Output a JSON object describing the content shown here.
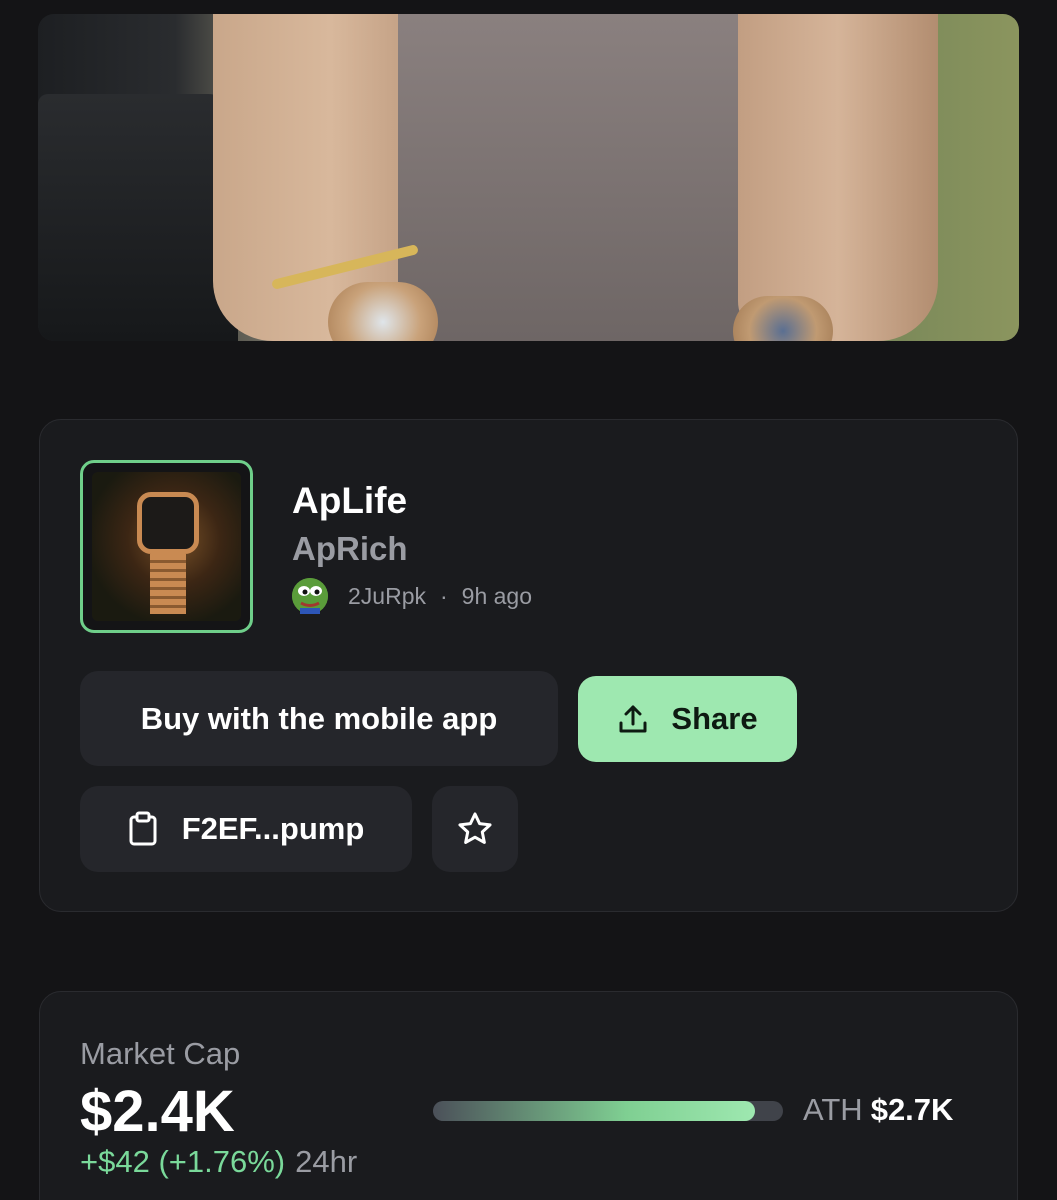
{
  "token": {
    "name": "ApLife",
    "ticker": "ApRich",
    "creator": "2JuRpk",
    "separator": "·",
    "age": "9h ago"
  },
  "actions": {
    "buy_label": "Buy with the mobile app",
    "share_label": "Share",
    "contract_label": "F2EF...pump"
  },
  "market": {
    "label": "Market Cap",
    "value": "$2.4K",
    "change": "+$42 (+1.76%)",
    "period": "24hr",
    "ath_label": "ATH",
    "ath_value": "$2.7K",
    "ath_progress": 0.92
  },
  "colors": {
    "accent": "#9ee8b0",
    "positive": "#7ad99a",
    "background": "#141416",
    "card": "#1a1b1e"
  },
  "icons": {
    "share": "upload-icon",
    "contract": "clipboard-icon",
    "favorite": "star-icon"
  }
}
